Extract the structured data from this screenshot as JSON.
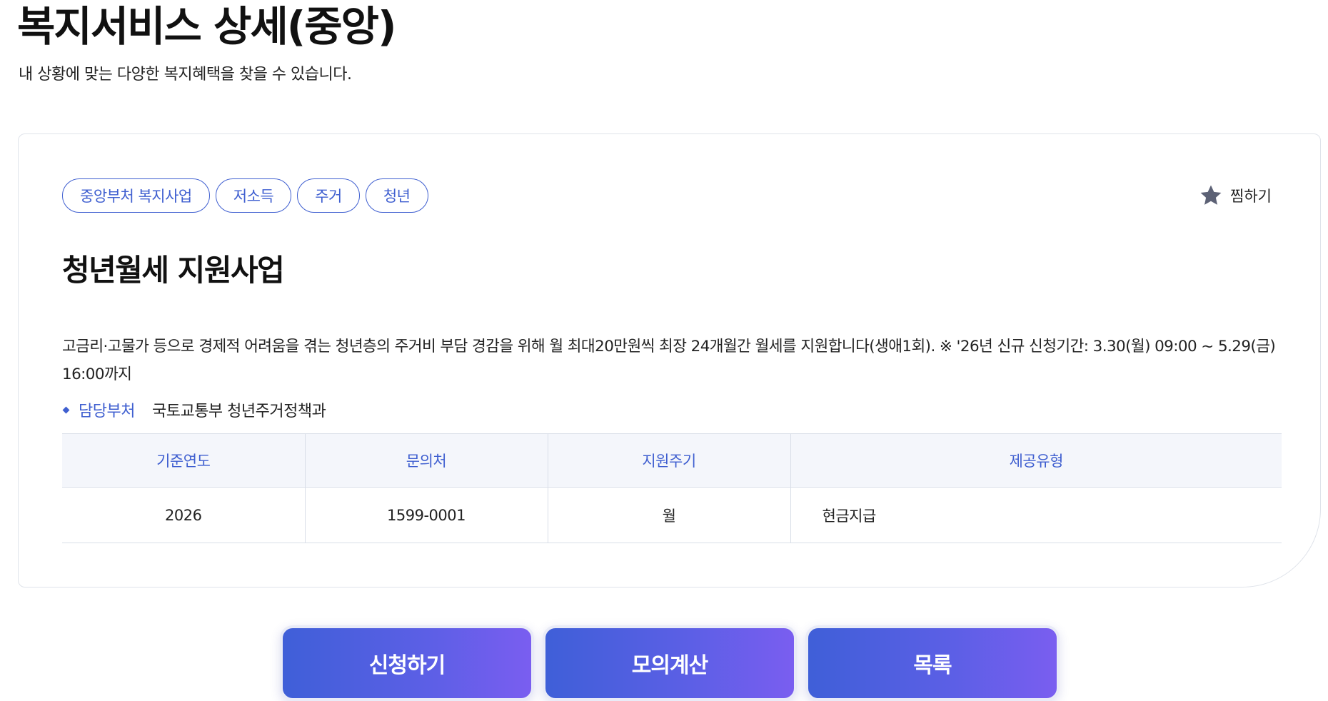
{
  "header": {
    "title": "복지서비스 상세(중앙)",
    "subtitle": "내 상황에 맞는 다양한 복지혜택을 찾을 수 있습니다."
  },
  "service": {
    "tags": [
      "중앙부처 복지사업",
      "저소득",
      "주거",
      "청년"
    ],
    "bookmark_label": "찜하기",
    "title": "청년월세 지원사업",
    "description": "고금리·고물가 등으로 경제적 어려움을 겪는 청년층의 주거비 부담 경감을 위해 월 최대20만원씩 최장 24개월간 월세를 지원합니다(생애1회). ※ '26년 신규 신청기간: 3.30(월) 09:00 ~ 5.29(금) 16:00까지",
    "department_label": "담당부처",
    "department": "국토교통부 청년주거정책과"
  },
  "info_table": {
    "headers": [
      "기준연도",
      "문의처",
      "지원주기",
      "제공유형"
    ],
    "row": [
      "2026",
      "1599-0001",
      "월",
      "현금지급"
    ]
  },
  "actions": {
    "apply_label": "신청하기",
    "simulate_label": "모의계산",
    "list_label": "목록"
  },
  "colors": {
    "accent": "#3f5fd0",
    "button_gradient_start": "#3f5fd8",
    "button_gradient_end": "#7a5ef0",
    "star": "#5c6175"
  },
  "icons": {
    "bookmark": "star-icon"
  }
}
